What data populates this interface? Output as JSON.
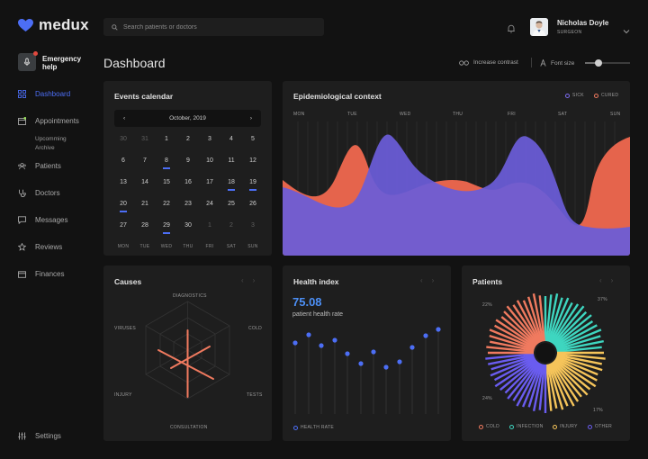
{
  "app": {
    "name": "medux"
  },
  "search": {
    "placeholder": "Search patients or doctors"
  },
  "user": {
    "name": "Nicholas Doyle",
    "role": "SURGEON"
  },
  "emergency": {
    "label": "Emergency help"
  },
  "nav": [
    {
      "label": "Dashboard",
      "active": true
    },
    {
      "label": "Appointments"
    },
    {
      "label": "Patients"
    },
    {
      "label": "Doctors"
    },
    {
      "label": "Messages"
    },
    {
      "label": "Reviews"
    },
    {
      "label": "Finances"
    }
  ],
  "subnav": [
    "Upcomming",
    "Archive"
  ],
  "settings": {
    "label": "Settings"
  },
  "page": {
    "title": "Dashboard",
    "contrast": "Increase contrast",
    "font_size": "Font size"
  },
  "calendar": {
    "title": "Events calendar",
    "month": "October, 2019",
    "days": [
      {
        "d": "30",
        "m": true
      },
      {
        "d": "31",
        "m": true
      },
      {
        "d": "1"
      },
      {
        "d": "2"
      },
      {
        "d": "3"
      },
      {
        "d": "4"
      },
      {
        "d": "5"
      },
      {
        "d": "6"
      },
      {
        "d": "7"
      },
      {
        "d": "8",
        "e": true
      },
      {
        "d": "9"
      },
      {
        "d": "10"
      },
      {
        "d": "11"
      },
      {
        "d": "12"
      },
      {
        "d": "13"
      },
      {
        "d": "14"
      },
      {
        "d": "15"
      },
      {
        "d": "16"
      },
      {
        "d": "17"
      },
      {
        "d": "18",
        "e": true
      },
      {
        "d": "19",
        "e": true
      },
      {
        "d": "20",
        "e": true
      },
      {
        "d": "21"
      },
      {
        "d": "22"
      },
      {
        "d": "23"
      },
      {
        "d": "24"
      },
      {
        "d": "25"
      },
      {
        "d": "26"
      },
      {
        "d": "27"
      },
      {
        "d": "28"
      },
      {
        "d": "29",
        "e": true
      },
      {
        "d": "30"
      },
      {
        "d": "1",
        "m": true
      },
      {
        "d": "2",
        "m": true
      },
      {
        "d": "3",
        "m": true
      }
    ],
    "weekdays": [
      "MON",
      "TUE",
      "WED",
      "THU",
      "FRI",
      "SAT",
      "SUN"
    ]
  },
  "epi": {
    "title": "Epidemiological context",
    "legend": [
      {
        "name": "SICK",
        "color": "#7b6cf0"
      },
      {
        "name": "CURED",
        "color": "#f07a5f"
      }
    ],
    "days": [
      "MON",
      "TUE",
      "WED",
      "THU",
      "FRI",
      "SAT",
      "SUN"
    ]
  },
  "causes": {
    "title": "Causes",
    "labels": [
      "DIAGNOSTICS",
      "COLD",
      "TESTS",
      "CONSULTATION",
      "INJURY",
      "VIRUSES"
    ]
  },
  "health": {
    "title": "Health index",
    "value": "75.08",
    "subtitle": "patient health rate",
    "legend": "HEALTH RATE"
  },
  "patients": {
    "title": "Patients",
    "legend": [
      {
        "name": "COLD",
        "color": "#f07a5f"
      },
      {
        "name": "INFECTION",
        "color": "#3ed6c0"
      },
      {
        "name": "INJURY",
        "color": "#f5c45a"
      },
      {
        "name": "OTHER",
        "color": "#6a5cf0"
      }
    ],
    "pct": {
      "a": "37%",
      "b": "22%",
      "c": "24%",
      "d": "17%"
    }
  },
  "colors": {
    "accent": "#4c6ef5",
    "bg": "#121212",
    "card": "#1e1e1e"
  }
}
